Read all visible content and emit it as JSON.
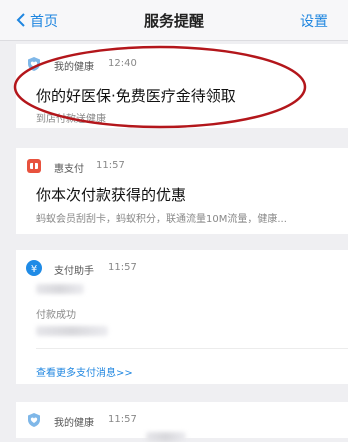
{
  "nav": {
    "back_label": "首页",
    "title": "服务提醒",
    "right_label": "设置"
  },
  "cards": [
    {
      "app_name": "我的健康",
      "time": "12:40",
      "headline": "你的好医保·免费医疗金待领取",
      "subtitle": "到店付款送健康",
      "icon": "heart-shield-icon",
      "icon_color": "#7fb7e8"
    },
    {
      "app_name": "惠支付",
      "time": "11:57",
      "headline": "你本次付款获得的优惠",
      "subtitle": "蚂蚁会员刮刮卡，蚂蚁积分，联通流量10M流量，健康...",
      "icon": "coupon-icon",
      "icon_color": "#e8523e"
    },
    {
      "app_name": "支付助手",
      "time": "11:57",
      "status": "付款成功",
      "more_link": "查看更多支付消息>>",
      "icon": "yen-icon",
      "icon_color": "#1f8be6"
    },
    {
      "app_name": "我的健康",
      "time": "11:57",
      "icon": "heart-shield-icon",
      "icon_color": "#7fb7e8"
    }
  ],
  "colors": {
    "accent": "#1f86e0",
    "annotation": "#b3161b"
  }
}
